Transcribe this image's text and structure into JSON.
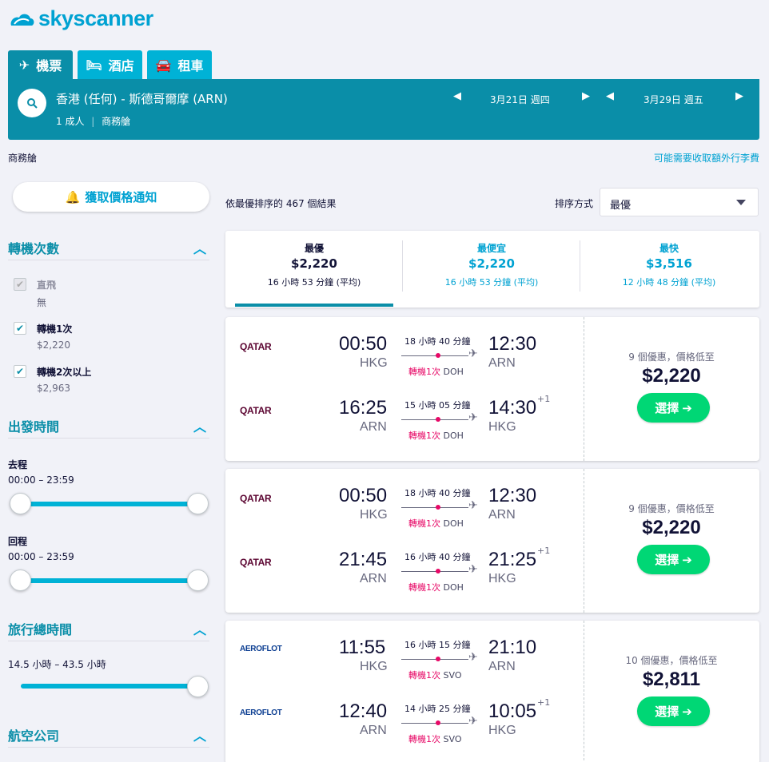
{
  "brand": {
    "name": "skyscanner"
  },
  "tabs": [
    {
      "label": "機票",
      "icon": "plane-icon"
    },
    {
      "label": "酒店",
      "icon": "bed-icon"
    },
    {
      "label": "租車",
      "icon": "car-icon"
    }
  ],
  "search": {
    "route": "香港 (任何) - 斯德哥爾摩 (ARN)",
    "passengers": "1 成人",
    "cabin": "商務艙",
    "depart_date": "3月21日 週四",
    "return_date": "3月29日 週五"
  },
  "subheader": {
    "cabin": "商務艙",
    "bag_fee": "可能需要收取額外行李費"
  },
  "alert_button": "獲取價格通知",
  "filters": {
    "stops": {
      "title": "轉機次數",
      "options": [
        {
          "label": "直飛",
          "sub": "無",
          "checked": false,
          "disabled": true
        },
        {
          "label": "轉機1次",
          "sub": "$2,220",
          "checked": true,
          "disabled": false
        },
        {
          "label": "轉機2次以上",
          "sub": "$2,963",
          "checked": true,
          "disabled": false
        }
      ]
    },
    "departure_times": {
      "title": "出發時間",
      "outbound_label": "去程",
      "outbound_range": "00:00 – 23:59",
      "return_label": "回程",
      "return_range": "00:00 – 23:59"
    },
    "duration": {
      "title": "旅行總時間",
      "range": "14.5 小時 – 43.5 小時"
    },
    "airlines": {
      "title": "航空公司"
    }
  },
  "results": {
    "count_text": "依最優排序的 467 個結果",
    "sort_label": "排序方式",
    "sort_value": "最優"
  },
  "summary": [
    {
      "title": "最優",
      "price": "$2,220",
      "duration": "16 小時 53 分鐘 (平均)",
      "active": true
    },
    {
      "title": "最便宜",
      "price": "$2,220",
      "duration": "16 小時 53 分鐘 (平均)",
      "active": false
    },
    {
      "title": "最快",
      "price": "$3,516",
      "duration": "12 小時 48 分鐘 (平均)",
      "active": false
    }
  ],
  "flights": [
    {
      "deals": "9 個優惠，價格低至",
      "price": "$2,220",
      "select": "選擇",
      "legs": [
        {
          "airline": "QATAR",
          "dep_time": "00:50",
          "dep_code": "HKG",
          "duration": "18 小時 40 分鐘",
          "stops": "轉機1次",
          "via": "DOH",
          "arr_time": "12:30",
          "arr_code": "ARN",
          "plus": ""
        },
        {
          "airline": "QATAR",
          "dep_time": "16:25",
          "dep_code": "ARN",
          "duration": "15 小時 05 分鐘",
          "stops": "轉機1次",
          "via": "DOH",
          "arr_time": "14:30",
          "arr_code": "HKG",
          "plus": "+1"
        }
      ]
    },
    {
      "deals": "9 個優惠，價格低至",
      "price": "$2,220",
      "select": "選擇",
      "legs": [
        {
          "airline": "QATAR",
          "dep_time": "00:50",
          "dep_code": "HKG",
          "duration": "18 小時 40 分鐘",
          "stops": "轉機1次",
          "via": "DOH",
          "arr_time": "12:30",
          "arr_code": "ARN",
          "plus": ""
        },
        {
          "airline": "QATAR",
          "dep_time": "21:45",
          "dep_code": "ARN",
          "duration": "16 小時 40 分鐘",
          "stops": "轉機1次",
          "via": "DOH",
          "arr_time": "21:25",
          "arr_code": "HKG",
          "plus": "+1"
        }
      ]
    },
    {
      "deals": "10 個優惠，價格低至",
      "price": "$2,811",
      "select": "選擇",
      "legs": [
        {
          "airline": "AEROFLOT",
          "dep_time": "11:55",
          "dep_code": "HKG",
          "duration": "16 小時 15 分鐘",
          "stops": "轉機1次",
          "via": "SVO",
          "arr_time": "21:10",
          "arr_code": "ARN",
          "plus": ""
        },
        {
          "airline": "AEROFLOT",
          "dep_time": "12:40",
          "dep_code": "ARN",
          "duration": "14 小時 25 分鐘",
          "stops": "轉機1次",
          "via": "SVO",
          "arr_time": "10:05",
          "arr_code": "HKG",
          "plus": "+1"
        }
      ]
    }
  ]
}
